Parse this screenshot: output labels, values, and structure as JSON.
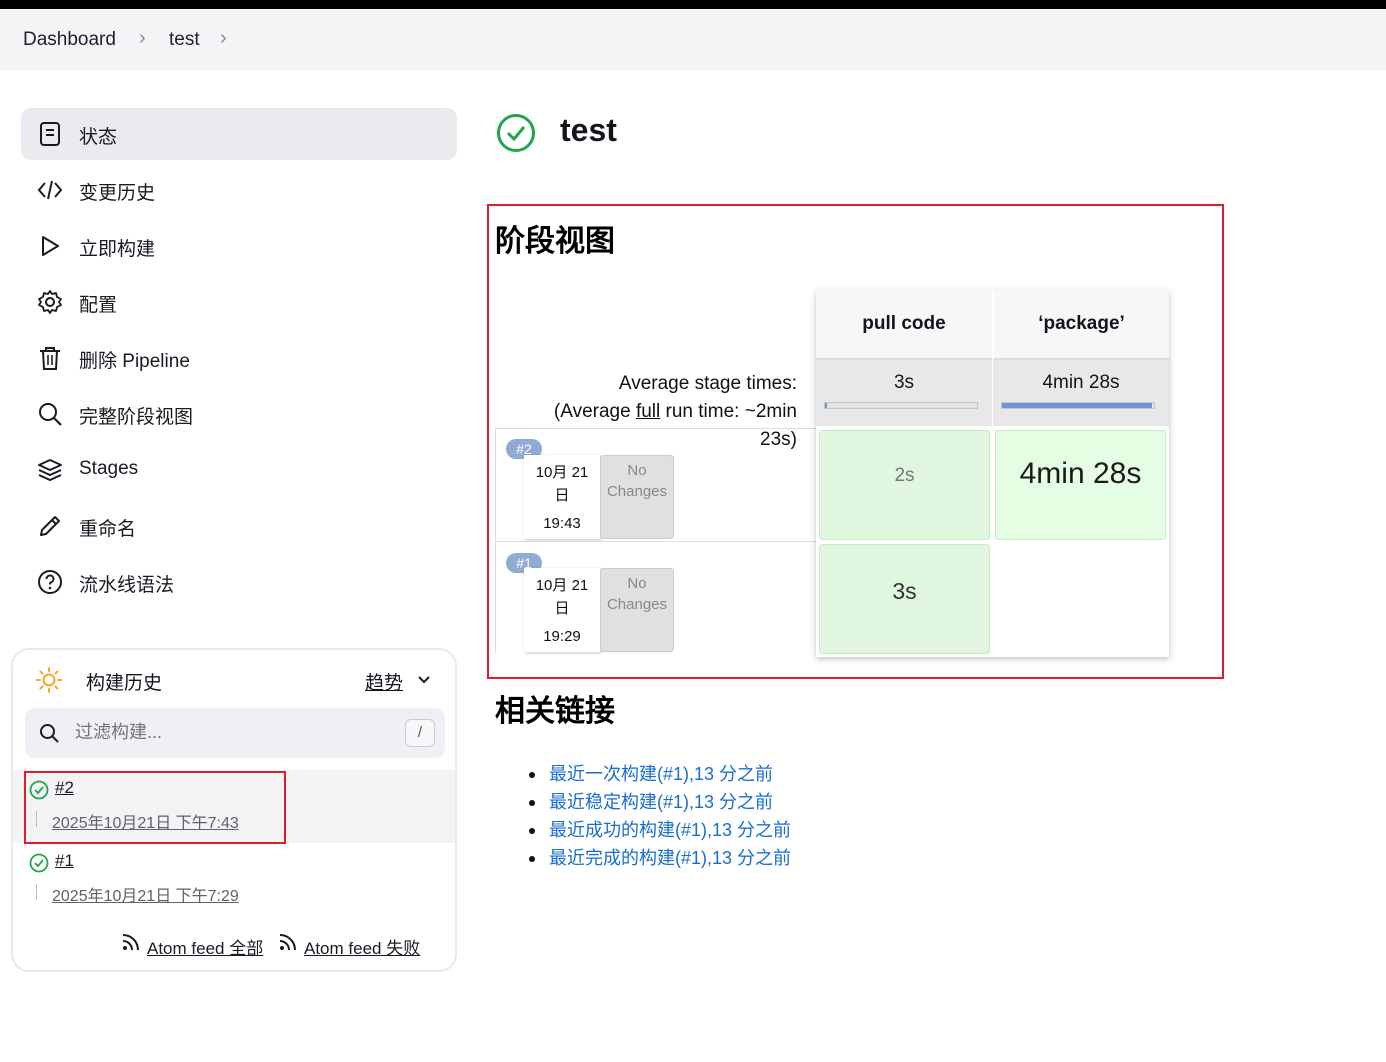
{
  "breadcrumb": {
    "items": [
      "Dashboard",
      "test"
    ]
  },
  "sidebar": {
    "items": [
      {
        "label": "状态",
        "icon": "status-icon"
      },
      {
        "label": "变更历史",
        "icon": "code-icon"
      },
      {
        "label": "立即构建",
        "icon": "play-icon"
      },
      {
        "label": "配置",
        "icon": "gear-icon"
      },
      {
        "label": "删除 Pipeline",
        "icon": "trash-icon"
      },
      {
        "label": "完整阶段视图",
        "icon": "search-icon"
      },
      {
        "label": "Stages",
        "icon": "layers-icon"
      },
      {
        "label": "重命名",
        "icon": "pencil-icon"
      },
      {
        "label": "流水线语法",
        "icon": "help-icon"
      }
    ]
  },
  "history": {
    "title": "构建历史",
    "trend": "趋势",
    "filter_placeholder": "过滤构建...",
    "shortcut": "/",
    "builds": [
      {
        "number": "#2",
        "date": "2025年10月21日 下午7:43"
      },
      {
        "number": "#1",
        "date": "2025年10月21日 下午7:29"
      }
    ],
    "atom_all": "Atom feed 全部",
    "atom_fail": "Atom feed 失败"
  },
  "main": {
    "title": "test",
    "stage_view_title": "阶段视图",
    "avg_label_1": "Average stage times:",
    "avg_label_2_pre": "(Average ",
    "avg_label_2_link": "full",
    "avg_label_2_post": " run time: ~2min",
    "avg_label_3": "23s)",
    "stages": [
      {
        "name": "pull code",
        "avg": "3s",
        "avg_fraction": 0.01
      },
      {
        "name": "‘package’",
        "avg": "4min 28s",
        "avg_fraction": 0.99
      }
    ],
    "runs": [
      {
        "badge": "#2",
        "date_line1": "10月 21",
        "date_line2": "日",
        "time": "19:43",
        "changes": "No Changes",
        "cells": [
          "2s",
          "4min 28s"
        ]
      },
      {
        "badge": "#1",
        "date_line1": "10月 21",
        "date_line2": "日",
        "time": "19:29",
        "changes": "No Changes",
        "cells": [
          "3s",
          ""
        ]
      }
    ],
    "related_title": "相关链接",
    "links": [
      "最近一次构建(#1),13 分之前",
      "最近稳定构建(#1),13 分之前",
      "最近成功的构建(#1),13 分之前",
      "最近完成的构建(#1),13 分之前"
    ]
  },
  "colors": {
    "accent": "#1a6dcf",
    "success": "#1ea64b",
    "highlight_border": "#dd1f2d"
  }
}
